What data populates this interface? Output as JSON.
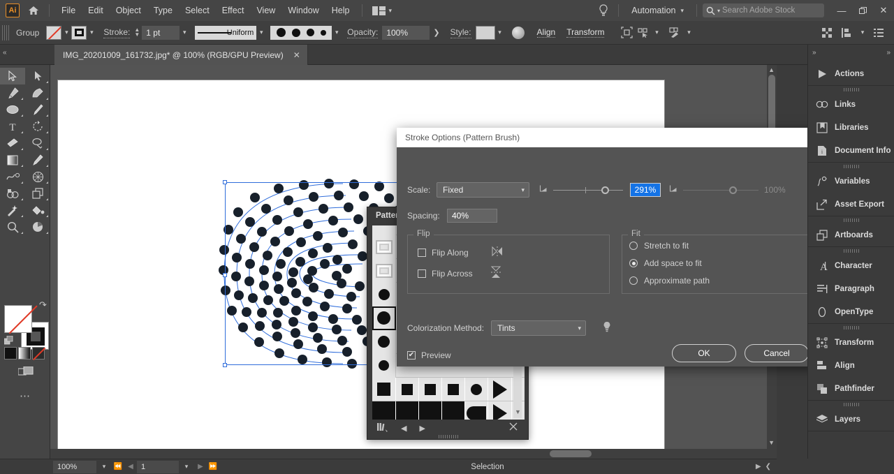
{
  "menubar": {
    "app_logo": "Ai",
    "home_icon": "home-icon",
    "items": [
      "File",
      "Edit",
      "Object",
      "Type",
      "Select",
      "Effect",
      "View",
      "Window",
      "Help"
    ],
    "arrange_icon": "arrange-documents-icon",
    "bulb_icon": "discover-bulb-icon",
    "automation_label": "Automation",
    "search_placeholder": "Search Adobe Stock",
    "search_icon": "search-icon",
    "window_buttons": {
      "minimize": "—",
      "restore": "❐",
      "close": "✕"
    }
  },
  "controlbar": {
    "selection_label": "Group",
    "fill_swatch": "none-fill-swatch",
    "stroke_swatch": "black-stroke-swatch",
    "stroke_label": "Stroke:",
    "stroke_weight": "1 pt",
    "profile_label": "Uniform",
    "opacity_label": "Opacity:",
    "opacity_value": "100%",
    "style_label": "Style:",
    "recolor_icon": "recolor-artwork-icon",
    "align_label": "Align",
    "transform_label": "Transform",
    "isolate_icon": "isolate-selected-object-icon",
    "select_similar_icon": "select-similar-objects-icon",
    "draw_inside_icon": "draw-behind-icon",
    "arrange_grid_icon": "arrange-grid-icon",
    "distribute_icon": "distribute-icon",
    "document_setup_icon": "document-setup-icon"
  },
  "tabstrip": {
    "document_title": "IMG_20201009_161732.jpg* @ 100% (RGB/GPU Preview)",
    "close_glyph": "✕"
  },
  "toolbar": {
    "tools": [
      "selection-tool",
      "direct-selection-tool",
      "pen-tool",
      "curvature-tool",
      "ellipse-tool",
      "paintbrush-tool",
      "type-tool",
      "rotate-tool",
      "eraser-tool",
      "lasso-tool",
      "gradient-tool",
      "eyedropper-tool",
      "blend-tool",
      "perspective-grid-tool",
      "shape-builder-tool",
      "artboard-tool",
      "magic-wand-tool",
      "live-paint-bucket-tool",
      "zoom-tool",
      "graph-tool"
    ],
    "fill_swatch": "fill-none-swatch",
    "stroke_swatch": "stroke-black-swatch",
    "swap_icon": "swap-fill-stroke-icon",
    "default_icon": "default-fill-stroke-icon",
    "color_mode": "color-mode-button",
    "gradient_mode": "gradient-mode-button",
    "none_mode": "none-mode-button",
    "screen_mode_icon": "change-screen-mode-icon",
    "more_tools_icon": "edit-toolbar-icon"
  },
  "canvas": {
    "artwork_name": "fingerprint-pattern-artwork",
    "selection_box": "selection-bounding-box"
  },
  "brush_panel": {
    "tab_label": "Pattern",
    "library_icon": "brush-libraries-menu-icon",
    "prev_icon": "previous-library-icon",
    "next_icon": "next-library-icon",
    "remove_icon": "remove-brush-icon",
    "swatches": [
      "border-frame-brush",
      "border-frame-brush-2",
      "dot-brush-small",
      "dot-brush-selected",
      "dot-brush-medium",
      "dot-brush-large",
      "square-pattern-brush",
      "rounded-bar-pattern-brush"
    ]
  },
  "dialog": {
    "title": "Stroke Options (Pattern Brush)",
    "scale_label": "Scale:",
    "scale_mode": "Fixed",
    "scale_value": "291%",
    "scale_max_value": "100%",
    "spacing_label": "Spacing:",
    "spacing_value": "40%",
    "flip": {
      "legend": "Flip",
      "along_label": "Flip Along",
      "along_checked": false,
      "along_icon": "flip-along-icon",
      "across_label": "Flip Across",
      "across_checked": false,
      "across_icon": "flip-across-icon"
    },
    "fit": {
      "legend": "Fit",
      "options": [
        "Stretch to fit",
        "Add space to fit",
        "Approximate path"
      ],
      "selected": "Add space to fit"
    },
    "colorization_label": "Colorization Method:",
    "colorization_value": "Tints",
    "colorization_tip_icon": "colorization-tip-icon",
    "preview_label": "Preview",
    "preview_checked": true,
    "ok_label": "OK",
    "cancel_label": "Cancel"
  },
  "rightdock": {
    "groups": [
      {
        "items": [
          {
            "label": "Actions",
            "icon": "actions-play-icon"
          }
        ]
      },
      {
        "items": [
          {
            "label": "Links",
            "icon": "links-icon"
          },
          {
            "label": "Libraries",
            "icon": "libraries-icon"
          },
          {
            "label": "Document Info",
            "icon": "document-info-icon"
          }
        ]
      },
      {
        "items": [
          {
            "label": "Variables",
            "icon": "variables-icon"
          },
          {
            "label": "Asset Export",
            "icon": "asset-export-icon"
          }
        ]
      },
      {
        "items": [
          {
            "label": "Artboards",
            "icon": "artboards-icon"
          }
        ]
      },
      {
        "items": [
          {
            "label": "Character",
            "icon": "character-icon"
          },
          {
            "label": "Paragraph",
            "icon": "paragraph-icon"
          },
          {
            "label": "OpenType",
            "icon": "opentype-icon"
          }
        ]
      },
      {
        "items": [
          {
            "label": "Transform",
            "icon": "transform-icon"
          },
          {
            "label": "Align",
            "icon": "align-icon"
          },
          {
            "label": "Pathfinder",
            "icon": "pathfinder-icon"
          }
        ]
      },
      {
        "items": [
          {
            "label": "Layers",
            "icon": "layers-icon"
          }
        ]
      }
    ]
  },
  "statusbar": {
    "zoom_value": "100%",
    "page_value": "1",
    "status_text": "Selection",
    "first_icon": "first-artboard-icon",
    "prev_icon": "previous-artboard-icon",
    "next_icon": "next-artboard-icon",
    "last_icon": "last-artboard-icon"
  },
  "colors": {
    "accent": "#1473e6",
    "window_bg": "#3b3b3b",
    "panel_bg": "#454545",
    "dialog_bg": "#545454",
    "selection_blue": "#2f6ddb",
    "logo_orange": "#e88e27"
  }
}
